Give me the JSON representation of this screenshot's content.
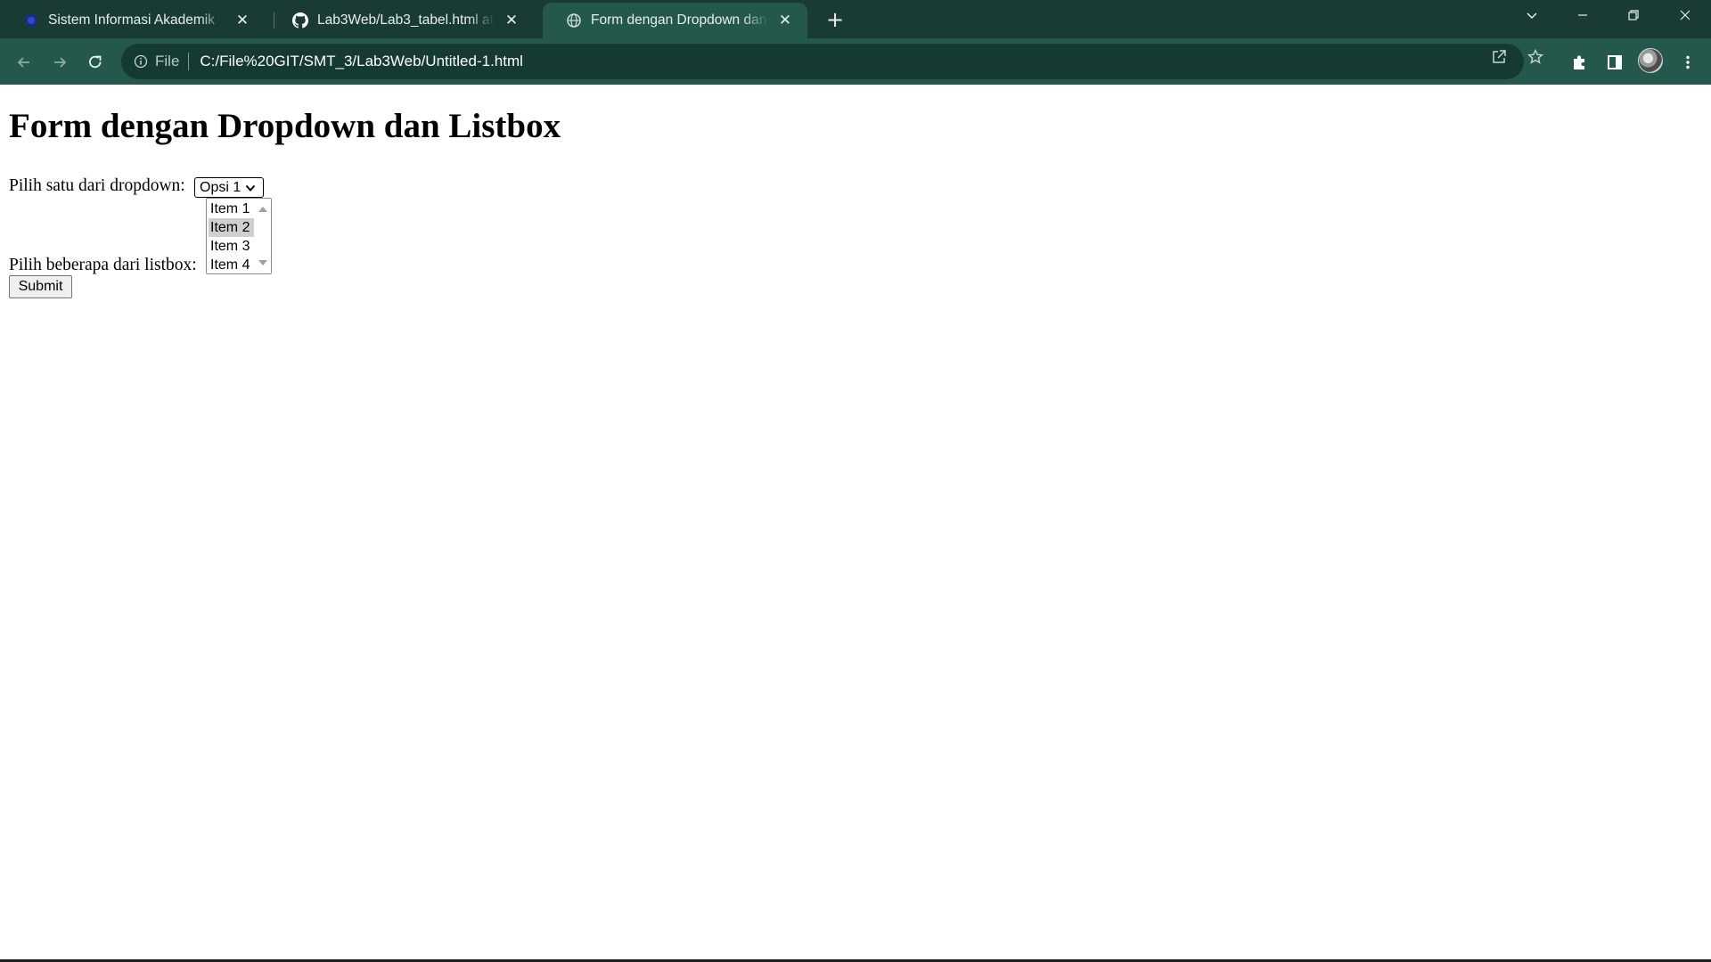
{
  "browser": {
    "tabs": [
      {
        "title": "Sistem Informasi Akademik",
        "favicon": "university-logo-icon",
        "active": false
      },
      {
        "title": "Lab3Web/Lab3_tabel.html at ma",
        "favicon": "github-icon",
        "active": false
      },
      {
        "title": "Form dengan Dropdown dan Lis",
        "favicon": "globe-icon",
        "active": true
      }
    ],
    "new_tab_label": "+",
    "address_bar": {
      "scheme_label": "File",
      "url": "C:/File%20GIT/SMT_3/Lab3Web/Untitled-1.html"
    }
  },
  "page": {
    "heading": "Form dengan Dropdown dan Listbox",
    "dropdown_label": "Pilih satu dari dropdown:",
    "dropdown_value": "Opsi 1",
    "listbox_label": "Pilih beberapa dari listbox:",
    "listbox_items": [
      "Item 1",
      "Item 2",
      "Item 3",
      "Item 4"
    ],
    "listbox_selected": "Item 2",
    "submit_label": "Submit"
  },
  "colors": {
    "tabstrip_bg": "#1a3b33",
    "toolbar_bg": "#24584c",
    "omnibox_bg": "#153a32"
  }
}
